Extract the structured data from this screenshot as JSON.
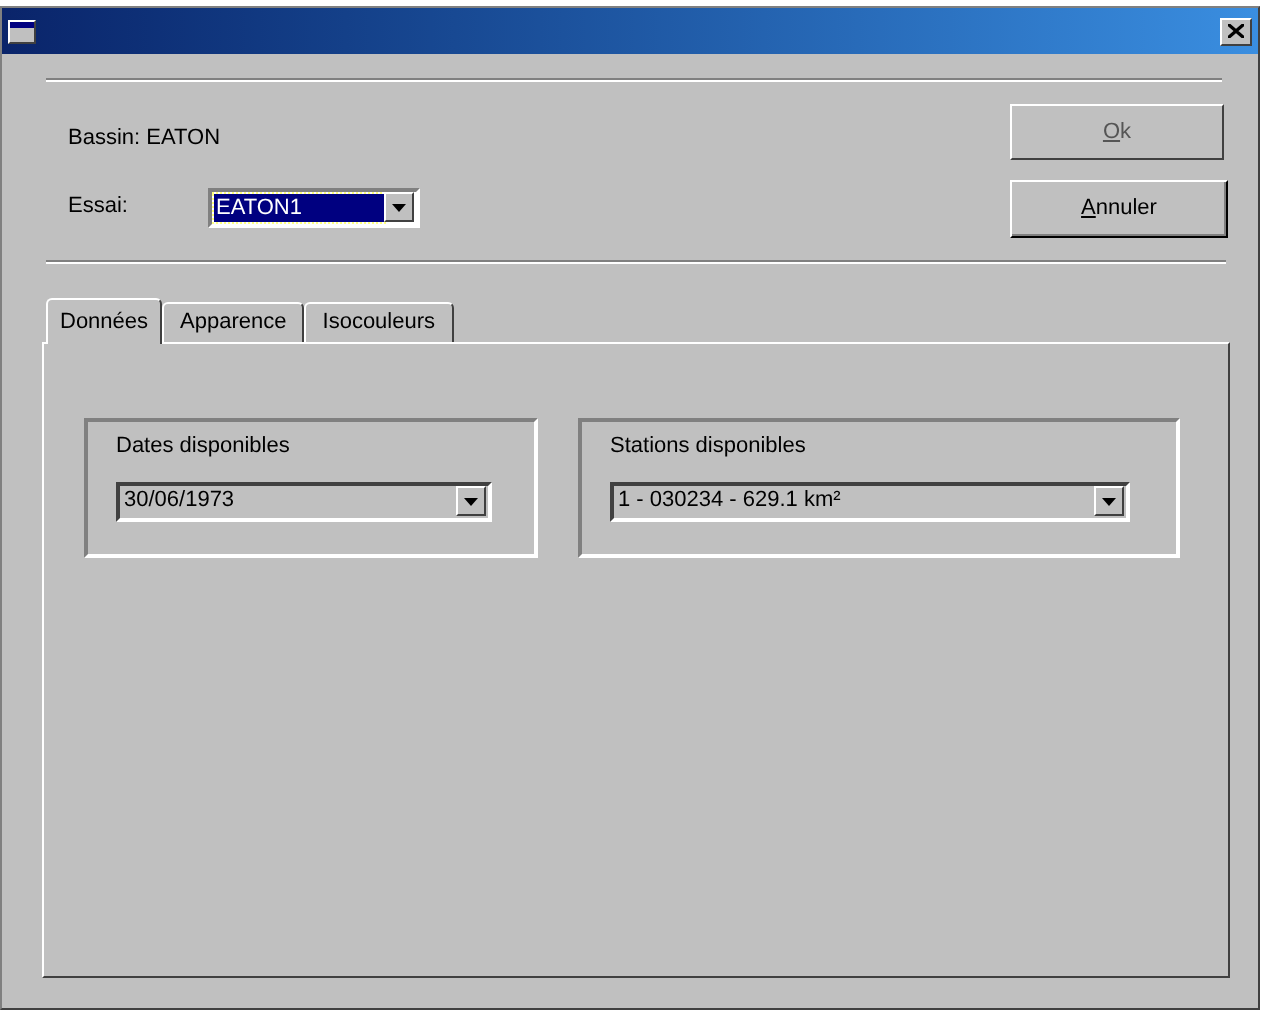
{
  "bassin_label": "Bassin: EATON",
  "essai": {
    "label": "Essai:",
    "value": "EATON1",
    "text_selected": true
  },
  "buttons": [
    {
      "label": "Ok"
    },
    {
      "label": "Annuler"
    }
  ],
  "tabs": [
    {
      "label": "Données",
      "selected": true
    },
    {
      "label": "Apparence",
      "selected": false
    },
    {
      "label": "Isocouleurs",
      "selected": false
    }
  ],
  "groups": [
    {
      "title": "Dates disponibles",
      "value": "30/06/1973"
    },
    {
      "title": "Stations disponibles",
      "value": "1 - 030234 - 629.1 km²"
    }
  ]
}
